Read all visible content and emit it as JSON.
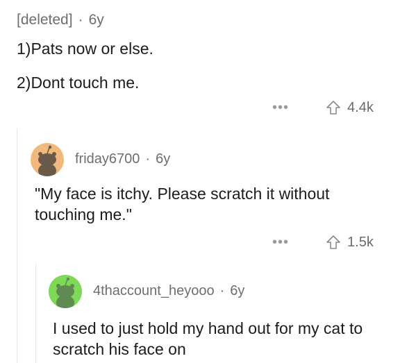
{
  "comments": [
    {
      "author": "[deleted]",
      "separator": "·",
      "age": "6y",
      "lines": [
        "1)Pats now or else.",
        "2)Dont touch me."
      ],
      "score": "4.4k",
      "more_label": "•••"
    },
    {
      "author": "friday6700",
      "separator": "·",
      "age": "6y",
      "avatar_color": "#f2b97f",
      "body": "\"My face is itchy. Please scratch it without touching me.\"",
      "score": "1.5k",
      "more_label": "•••"
    },
    {
      "author": "4thaccount_heyooo",
      "separator": "·",
      "age": "6y",
      "avatar_color": "#7ed957",
      "body": "I used to just hold my hand out for my cat to scratch his face on"
    }
  ],
  "colors": {
    "text": "#1c1c1c",
    "meta": "#6e6e6e",
    "thread_line": "#e8e8e8",
    "snoo_dark": "#6b5a4a",
    "snoo_green_dark": "#5f8a52"
  }
}
